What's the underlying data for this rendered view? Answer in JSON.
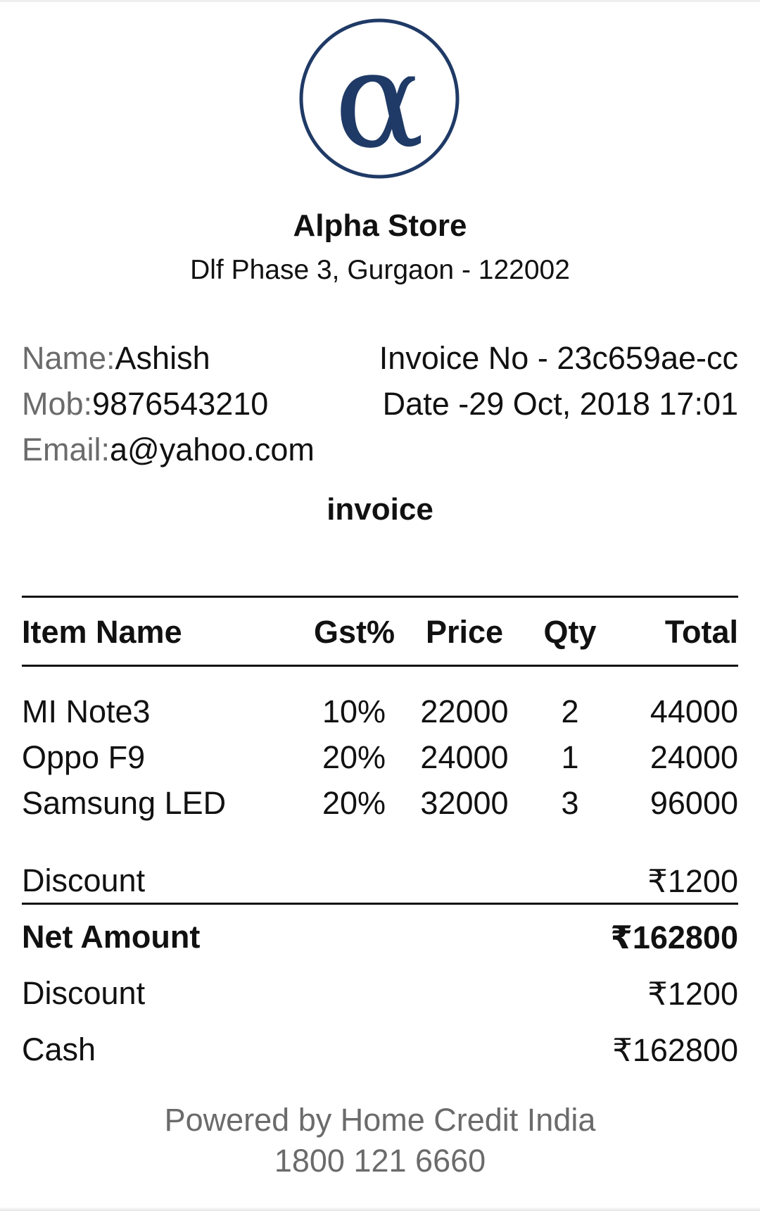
{
  "store": {
    "logo_glyph": "α",
    "logo_color": "#1f3a66",
    "name": "Alpha Store",
    "address": "Dlf Phase 3, Gurgaon - 122002"
  },
  "customer": {
    "name_label": "Name:",
    "name_value": "Ashish",
    "mob_label": "Mob:",
    "mob_value": "9876543210",
    "email_label": "Email:",
    "email_value": "a@yahoo.com"
  },
  "invoice_meta": {
    "invoice_no": "Invoice No - 23c659ae-cc",
    "date": "Date -29 Oct, 2018 17:01"
  },
  "document_title": "invoice",
  "table": {
    "headers": [
      "Item Name",
      "Gst%",
      "Price",
      "Qty",
      "Total"
    ],
    "rows": [
      [
        "MI Note3",
        "10%",
        "22000",
        "2",
        "44000"
      ],
      [
        "Oppo F9",
        "20%",
        "24000",
        "1",
        "24000"
      ],
      [
        "Samsung LED",
        "20%",
        "32000",
        "3",
        "96000"
      ]
    ]
  },
  "summary": {
    "discount_label": "Discount",
    "discount_value": "₹1200",
    "net_label": "Net Amount",
    "net_value": "₹162800",
    "payment_discount_label": "Discount",
    "payment_discount_value": "₹1200",
    "cash_label": "Cash",
    "cash_value": "₹162800"
  },
  "footer": {
    "powered_by": "Powered by Home Credit India",
    "phone": "1800 121 6660"
  }
}
